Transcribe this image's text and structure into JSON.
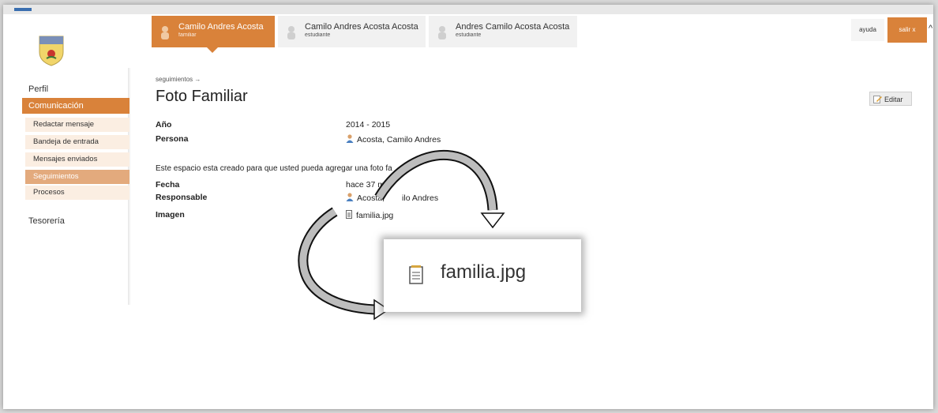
{
  "tabs": [
    {
      "name": "Camilo Andres Acosta",
      "role": "familiar"
    },
    {
      "name": "Camilo Andres Acosta Acosta",
      "role": "estudiante"
    },
    {
      "name": "Andres Camilo Acosta Acosta",
      "role": "estudiante"
    }
  ],
  "header": {
    "ayuda": "ayuda",
    "salir": "salir x"
  },
  "sidebar": {
    "perfil": "Perfil",
    "comunicacion": "Comunicación",
    "items": [
      "Redactar mensaje",
      "Bandeja de entrada",
      "Mensajes enviados",
      "Seguimientos",
      "Procesos"
    ],
    "tesoreria": "Tesorería"
  },
  "main": {
    "breadcrumb": "seguimientos →",
    "title": "Foto Familiar",
    "edit_label": "Editar",
    "fields": {
      "anio_label": "Año",
      "anio_value": "2014 - 2015",
      "persona_label": "Persona",
      "persona_value": "Acosta, Camilo Andres",
      "description": "Este espacio esta creado para que usted pueda agregar una foto fa",
      "fecha_label": "Fecha",
      "fecha_value": "hace 37 mi",
      "responsable_label": "Responsable",
      "responsable_value_a": "Acosta,",
      "responsable_value_b": "ilo Andres",
      "imagen_label": "Imagen",
      "imagen_value": "familia.jpg"
    }
  },
  "zoom_callout": {
    "filename": "familia.jpg"
  },
  "colors": {
    "accent": "#d9823a",
    "accent_light": "#fbeee2",
    "selected": "#e3aa7d"
  }
}
